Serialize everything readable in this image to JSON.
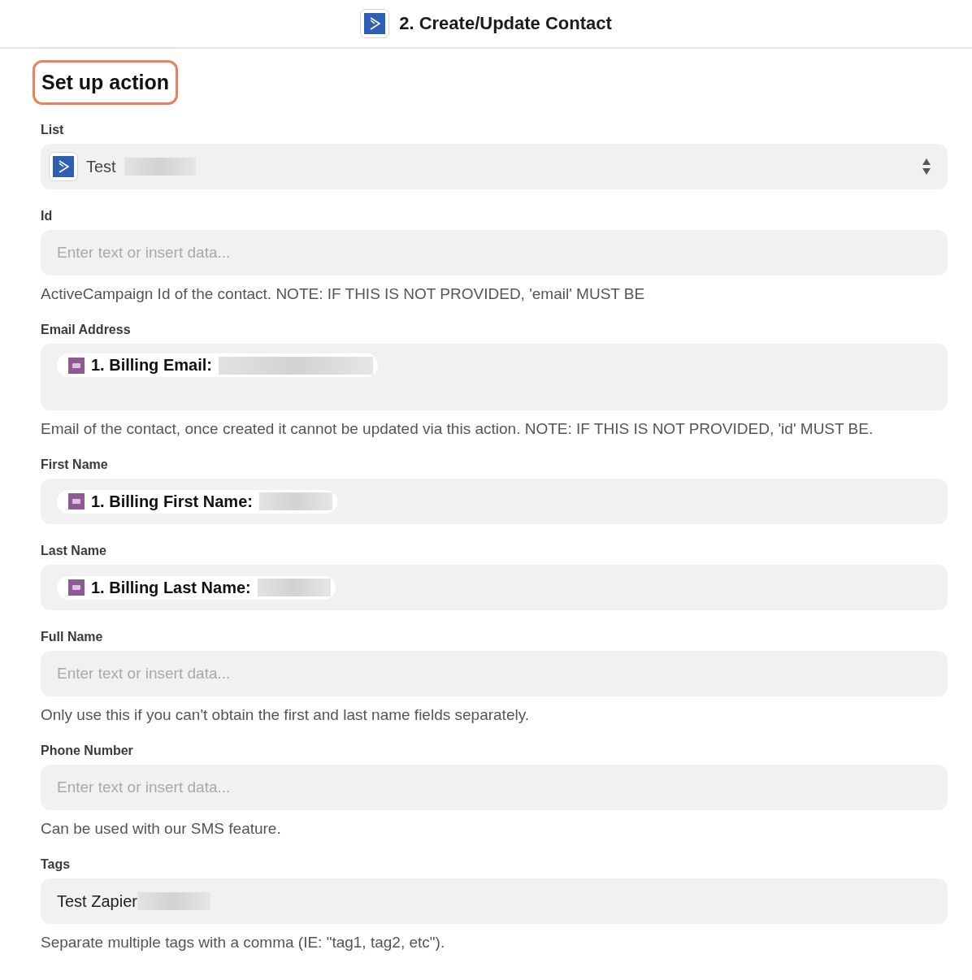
{
  "header": {
    "title": "2. Create/Update Contact"
  },
  "section": {
    "title": "Set up action",
    "highlighted": true
  },
  "fields": [
    {
      "kind": "select",
      "label": "List",
      "value": "Test",
      "redacted": true
    },
    {
      "kind": "text",
      "label": "Id",
      "placeholder": "Enter text or insert data...",
      "help": "ActiveCampaign Id of the contact. NOTE: IF THIS IS NOT PROVIDED, 'email' MUST BE"
    },
    {
      "kind": "pill",
      "label": "Email Address",
      "pill": "1. Billing Email:",
      "redacted": true,
      "multiline": true,
      "help": "Email of the contact, once created it cannot be updated via this action. NOTE: IF THIS IS NOT PROVIDED, 'id' MUST BE."
    },
    {
      "kind": "pill",
      "label": "First Name",
      "pill": "1. Billing First Name:",
      "redacted": true,
      "multiline": false
    },
    {
      "kind": "pill",
      "label": "Last Name",
      "pill": "1. Billing Last Name:",
      "redacted": true,
      "multiline": false
    },
    {
      "kind": "text",
      "label": "Full Name",
      "placeholder": "Enter text or insert data...",
      "help": "Only use this if you can't obtain the first and last name fields separately."
    },
    {
      "kind": "text",
      "label": "Phone Number",
      "placeholder": "Enter text or insert data...",
      "help": "Can be used with our SMS feature."
    },
    {
      "kind": "value",
      "label": "Tags",
      "value": "Test Zapier",
      "redacted": true,
      "help": "Separate multiple tags with a comma (IE: \"tag1, tag2, etc\")."
    }
  ]
}
